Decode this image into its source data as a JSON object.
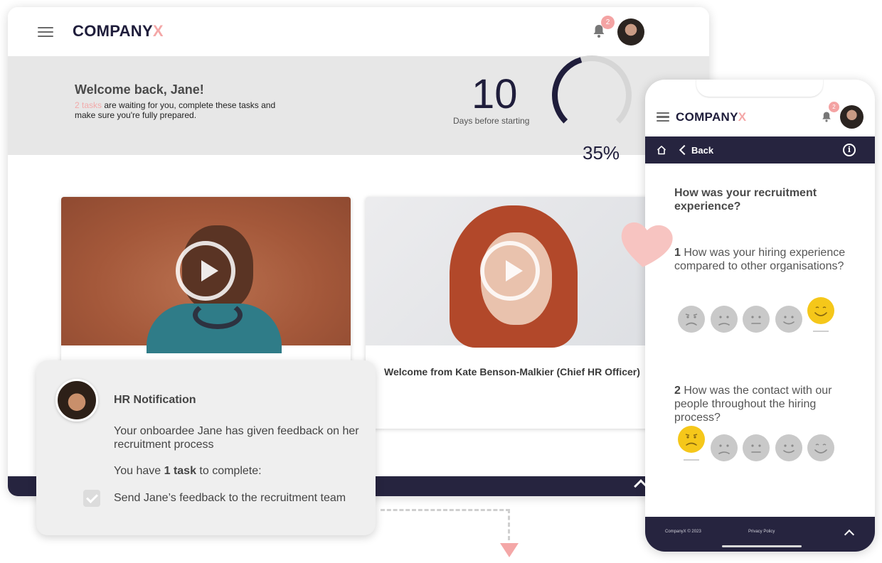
{
  "brand": {
    "name": "COMPANY",
    "x": "X"
  },
  "notifications_count": "2",
  "welcome": {
    "title": "Welcome back, Jane!",
    "tasks_link": "2 tasks",
    "subtitle_rest": " are waiting for you, complete these tasks and make sure you're fully prepared."
  },
  "countdown": {
    "days": "10",
    "label": "Days before starting"
  },
  "progress": {
    "percent_label": "35%",
    "fraction": 0.35
  },
  "videos": [
    {
      "title": ""
    },
    {
      "title": "Welcome from Kate Benson-Malkier (Chief HR Officer)"
    }
  ],
  "notification": {
    "title": "HR Notification",
    "body": "Your onboardee Jane has given feedback on her recruitment process",
    "tasks_prefix": "You have ",
    "tasks_count": "1 task",
    "tasks_suffix": " to complete:",
    "task_item": "Send Jane’s feedback to the recruitment team"
  },
  "phone": {
    "back_label": "Back",
    "info_icon": "i",
    "survey_title": "How was your recruitment experience?",
    "questions": [
      {
        "num": "1",
        "text": " How was your hiring experience compared to other organisations?",
        "selected": 4
      },
      {
        "num": "2",
        "text": " How was the contact with our people throughout the hiring process?",
        "selected": 0
      }
    ],
    "footer": {
      "copyright": "CompanyX © 2023",
      "privacy": "Privacy Policy"
    }
  },
  "colors": {
    "navy": "#26243f",
    "accent_pink": "#f4a7a7",
    "selected_face": "#f5c71a"
  }
}
